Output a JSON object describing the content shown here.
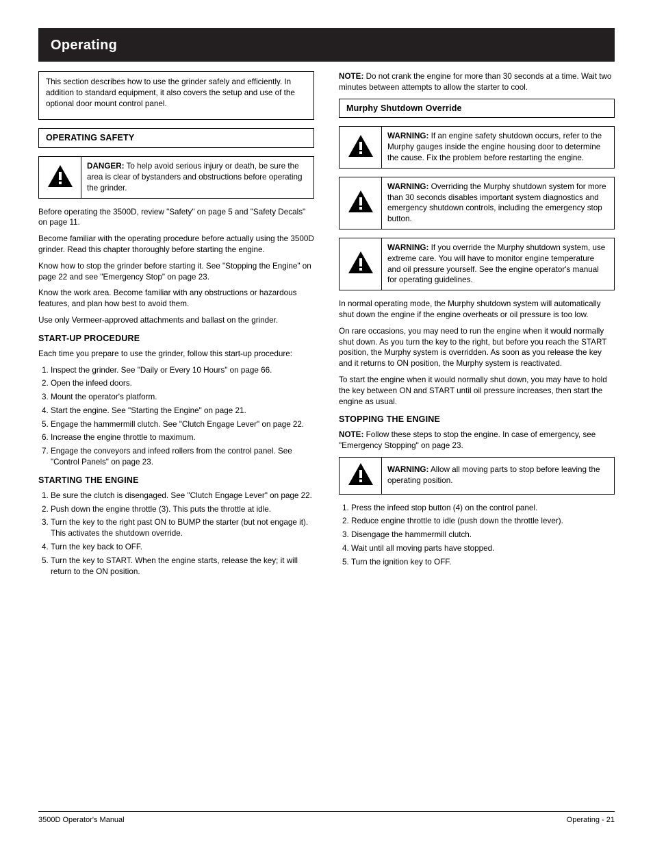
{
  "banner": {
    "title": "Operating"
  },
  "left": {
    "intro_box": [
      "This section describes how to use the grinder safely and efficiently. In addition to standard equipment, it also covers the setup and use of the optional door mount control panel."
    ],
    "safety_title": "OPERATING SAFETY",
    "danger": {
      "kw": "DANGER:",
      "text": "To help avoid serious injury or death, be sure the area is clear of bystanders and obstructions before operating the grinder."
    },
    "para1": "Before operating the 3500D, review \"Safety\" on page 5 and \"Safety Decals\" on page 11.",
    "para2": "Become familiar with the operating procedure before actually using the 3500D grinder. Read this chapter thoroughly before starting the engine.",
    "para3": "Know how to stop the grinder before starting it. See \"Stopping the Engine\" on page 22 and see \"Emergency Stop\" on page 23.",
    "para4": "Know the work area. Become familiar with any obstructions or hazardous features, and plan how best to avoid them.",
    "para5": "Use only Vermeer-approved attachments and ballast on the grinder.",
    "startup_title": "START-UP PROCEDURE",
    "startup_lead": "Each time you prepare to use the grinder, follow this start-up procedure:",
    "startup_steps": [
      "Inspect the grinder. See \"Daily or Every 10 Hours\" on page 66.",
      "Open the infeed doors.",
      "Mount the operator's platform.",
      "Start the engine. See \"Starting the Engine\" on page 21.",
      "Engage the hammermill clutch. See \"Clutch Engage Lever\" on page 22.",
      "Increase the engine throttle to maximum.",
      "Engage the conveyors and infeed rollers from the control panel. See \"Control Panels\" on page 23."
    ],
    "engine_title": "STARTING THE ENGINE",
    "engine_steps": [
      "Be sure the clutch is disengaged. See \"Clutch Engage Lever\" on page 22.",
      "Push down the engine throttle (3). This puts the throttle at idle.",
      "Turn the key to the right past ON to BUMP the starter (but not engage it). This activates the shutdown override.",
      "Turn the key back to OFF.",
      "Turn the key to START. When the engine starts, release the key; it will return to the ON position."
    ]
  },
  "right": {
    "note1_kw": "NOTE:",
    "note1_text": " Do not crank the engine for more than 30 seconds at a time. Wait two minutes between attempts to allow the starter to cool.",
    "murphy_title": "Murphy Shutdown Override",
    "warn1": {
      "kw": "WARNING:",
      "text": "If an engine safety shutdown occurs, refer to the Murphy gauges inside the engine housing door to determine the cause. Fix the problem before restarting the engine."
    },
    "warn2": {
      "kw": "WARNING:",
      "text": "Overriding the Murphy shutdown system for more than 30 seconds disables important system diagnostics and emergency shutdown controls, including the emergency stop button."
    },
    "warn3": {
      "kw": "WARNING:",
      "text": "If you override the Murphy shutdown system, use extreme care. You will have to monitor engine temperature and oil pressure yourself. See the engine operator's manual for operating guidelines."
    },
    "murphy_para1": "In normal operating mode, the Murphy shutdown system will automatically shut down the engine if the engine overheats or oil pressure is too low.",
    "murphy_para2": "On rare occasions, you may need to run the engine when it would normally shut down. As you turn the key to the right, but before you reach the START position, the Murphy system is overridden. As soon as you release the key and it returns to ON position, the Murphy system is reactivated.",
    "murphy_para3": "To start the engine when it would normally shut down, you may have to hold the key between ON and START until oil pressure increases, then start the engine as usual.",
    "stop_title": "STOPPING THE ENGINE",
    "note2_kw": "NOTE:",
    "note2_text": " Follow these steps to stop the engine. In case of emergency, see \"Emergency Stopping\" on page 23.",
    "warn4": {
      "kw": "WARNING:",
      "text": "Allow all moving parts to stop before leaving the operating position."
    },
    "stop_steps": [
      "Press the infeed stop button (4) on the control panel.",
      "Reduce engine throttle to idle (push down the throttle lever).",
      "Disengage the hammermill clutch.",
      "Wait until all moving parts have stopped.",
      "Turn the ignition key to OFF."
    ]
  },
  "footer": {
    "left": "3500D Operator's Manual",
    "right": "Operating - 21"
  }
}
